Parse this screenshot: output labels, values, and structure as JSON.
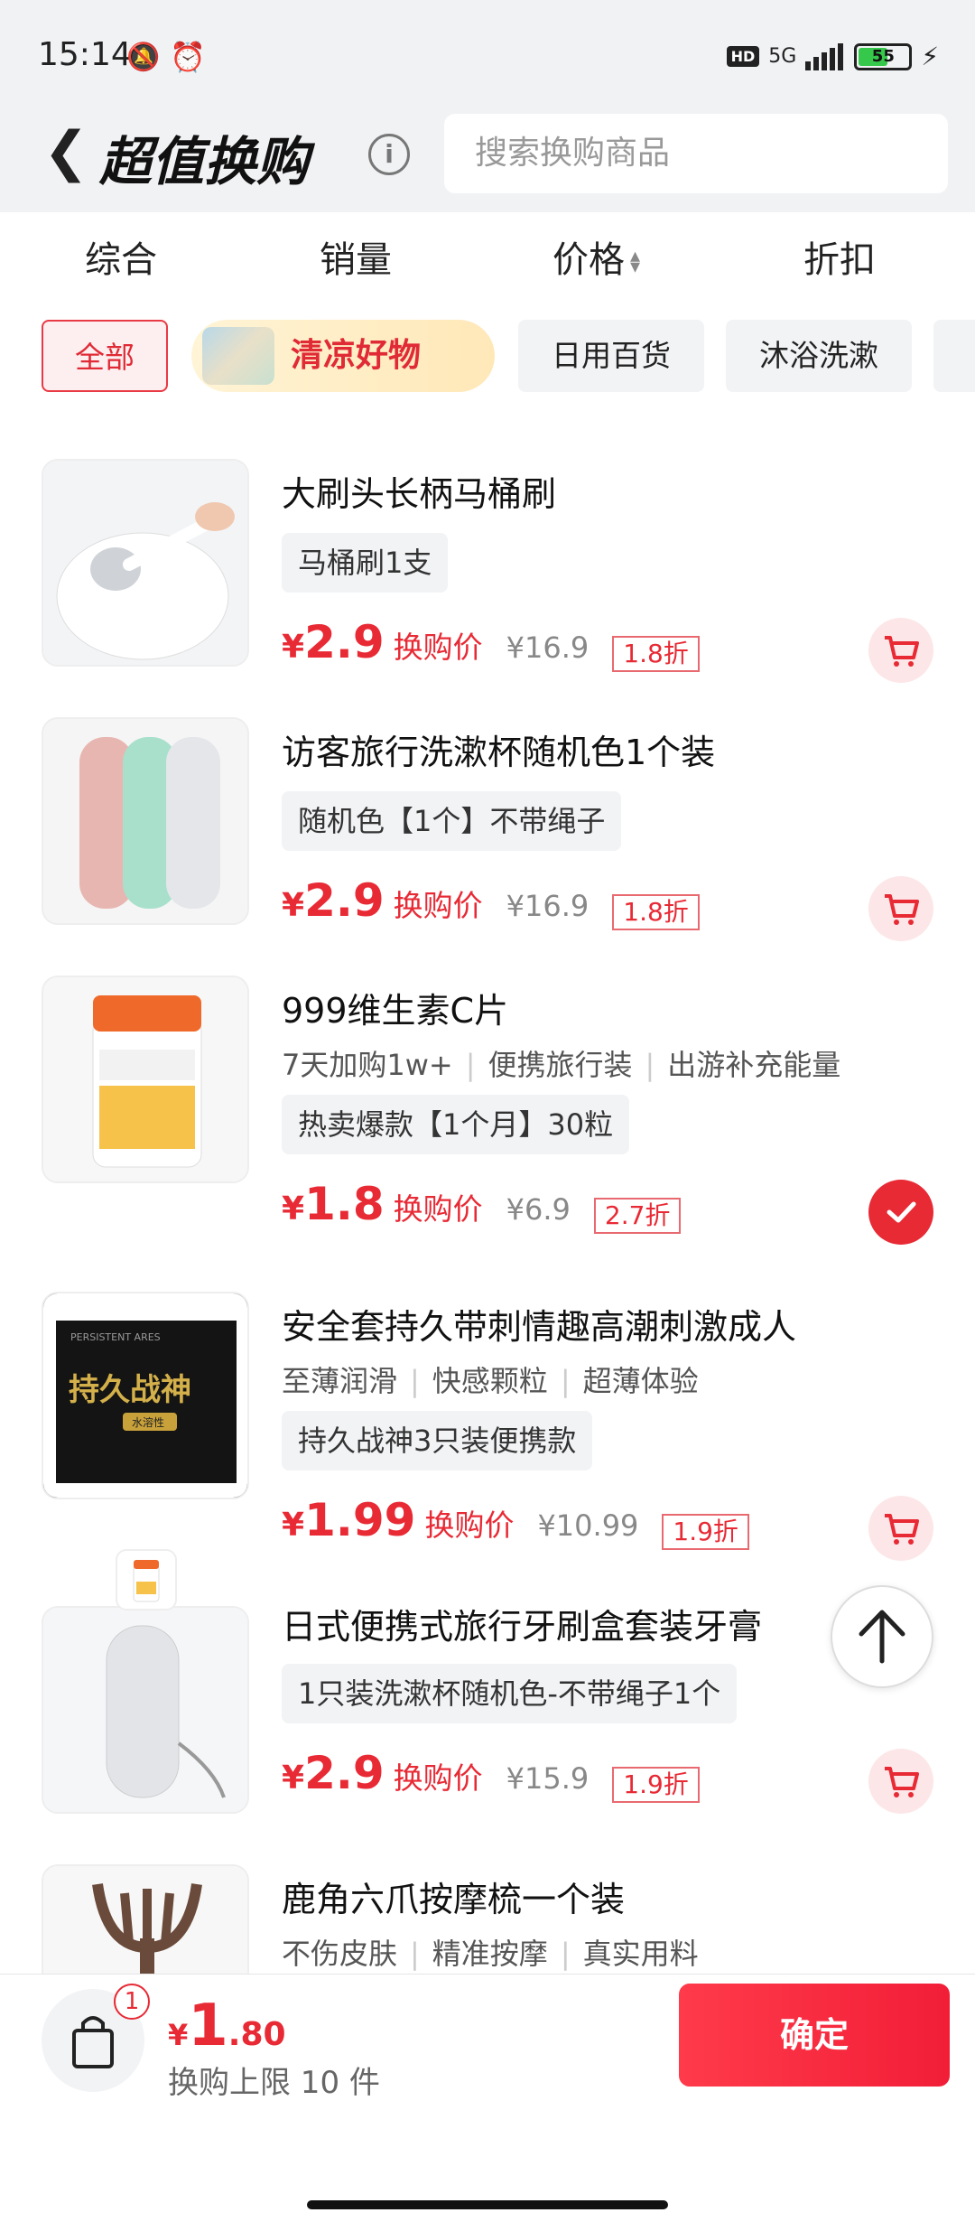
{
  "status": {
    "time": "15:14",
    "hd": "HD",
    "network": "5G",
    "battery": "55"
  },
  "header": {
    "title": "超值换购",
    "search_placeholder": "搜索换购商品"
  },
  "sort": [
    "综合",
    "销量",
    "价格",
    "折扣"
  ],
  "chips": [
    "全部",
    "清凉好物",
    "日用百货",
    "沐浴洗漱"
  ],
  "currency": "¥",
  "price_label": "换购价",
  "items": [
    {
      "name": "大刷头长柄马桶刷",
      "tags": [],
      "spec": "马桶刷1支",
      "price": "2.9",
      "orig": "¥16.9",
      "disc": "1.8折",
      "selected": false
    },
    {
      "name": "访客旅行洗漱杯随机色1个装",
      "tags": [],
      "spec": "随机色【1个】不带绳子",
      "price": "2.9",
      "orig": "¥16.9",
      "disc": "1.8折",
      "selected": false
    },
    {
      "name": "999维生素C片",
      "tags": [
        "7天加购1w+",
        "便携旅行装",
        "出游补充能量"
      ],
      "spec": "热卖爆款【1个月】30粒",
      "price": "1.8",
      "orig": "¥6.9",
      "disc": "2.7折",
      "selected": true
    },
    {
      "name": "安全套持久带刺情趣高潮刺激成人",
      "tags": [
        "至薄润滑",
        "快感颗粒",
        "超薄体验"
      ],
      "spec": "持久战神3只装便携款",
      "price": "1.99",
      "orig": "¥10.99",
      "disc": "1.9折",
      "selected": false,
      "box_brand": "PERSISTENT ARES",
      "box_title": "持久战神",
      "box_sub": "水溶性"
    },
    {
      "name": "日式便携式旅行牙刷盒套装牙膏",
      "tags": [],
      "spec": "1只装洗漱杯随机色-不带绳子1个",
      "price": "2.9",
      "orig": "¥15.9",
      "disc": "1.9折",
      "selected": false
    },
    {
      "name": "鹿角六爪按摩梳一个装",
      "tags": [
        "不伤皮肤",
        "精准按摩",
        "真实用料"
      ],
      "spec": "",
      "price": "",
      "orig": "",
      "disc": "",
      "selected": false
    }
  ],
  "footer": {
    "badge": "1",
    "currency": "¥",
    "total_int": "1",
    "total_dec": ".80",
    "limit": "换购上限 10 件",
    "confirm": "确定"
  }
}
